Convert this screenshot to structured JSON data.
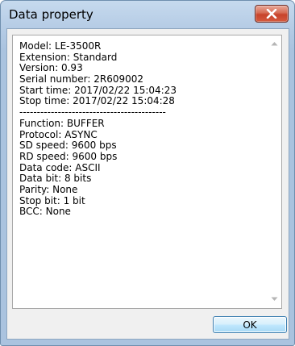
{
  "window": {
    "title": "Data property"
  },
  "content": {
    "lines": [
      "Model: LE-3500R",
      "Extension: Standard",
      "Version: 0.93",
      "Serial number: 2R609002",
      "Start time: 2017/02/22 15:04:23",
      "Stop time: 2017/02/22 15:04:28",
      "------------------------------------------",
      "Function: BUFFER",
      "Protocol: ASYNC",
      "SD speed: 9600 bps",
      "RD speed: 9600 bps",
      "Data code: ASCII",
      "Data bit: 8 bits",
      "Parity: None",
      "Stop bit: 1 bit",
      "BCC: None"
    ]
  },
  "buttons": {
    "ok_label": "OK"
  },
  "icons": {
    "close": "close-x-icon",
    "scroll_up": "scroll-up-arrow-icon",
    "scroll_down": "scroll-down-arrow-icon"
  },
  "colors": {
    "close_button": "#c7432a",
    "ok_button_border": "#3c7fb1"
  }
}
